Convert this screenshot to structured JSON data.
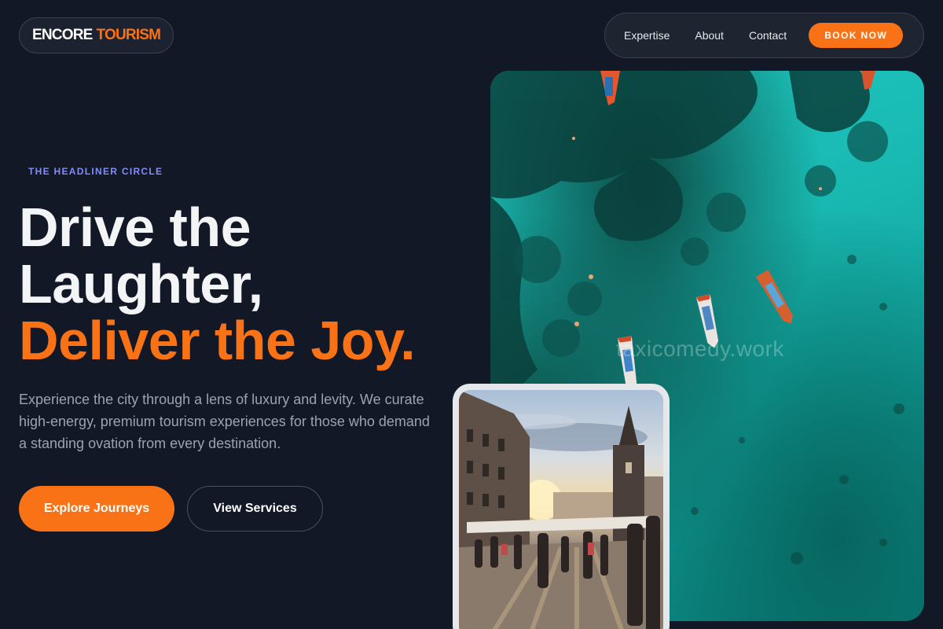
{
  "brand": {
    "word1": "ENCORE",
    "word2": "TOURISM"
  },
  "nav": {
    "items": [
      "Expertise",
      "About",
      "Contact"
    ],
    "cta": "BOOK NOW"
  },
  "hero": {
    "eyebrow": "THE HEADLINER CIRCLE",
    "headline_line1": "Drive the",
    "headline_line2": "Laughter,",
    "headline_line3": "Deliver the Joy.",
    "description": "Experience the city through a lens of luxury and levity. We curate high-energy, premium tourism experiences for those who demand a standing ovation from every destination.",
    "primary_cta": "Explore Journeys",
    "secondary_cta": "View Services"
  },
  "images": {
    "main_watermark": "taxicomedy.work"
  },
  "colors": {
    "background": "#131827",
    "accent": "#f97316",
    "eyebrow": "#818cf8",
    "muted_text": "#9ca3af"
  }
}
